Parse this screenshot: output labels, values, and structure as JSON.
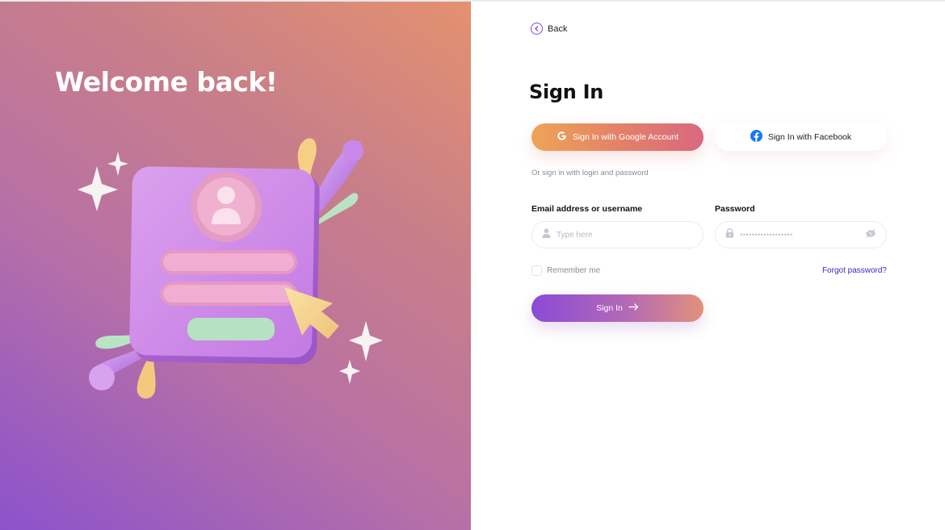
{
  "hero": {
    "title": "Welcome back!"
  },
  "nav": {
    "back_label": "Back"
  },
  "form": {
    "title": "Sign In",
    "google_button": "Sign In with Google Account",
    "facebook_button": "Sign In with Facebook",
    "divider_text": "Or sign in with login and password",
    "email_label": "Email address or username",
    "email_placeholder": "Type here",
    "email_value": "",
    "password_label": "Password",
    "password_masked": "••••••••••••••••••",
    "remember_label": "Remember me",
    "remember_checked": false,
    "forgot_label": "Forgot password?",
    "submit_label": "Sign In"
  },
  "icons": {
    "back": "chevron-left-circle-icon",
    "google": "google-icon",
    "facebook": "facebook-icon",
    "user": "user-icon",
    "lock": "lock-icon",
    "eye": "eye-off-icon",
    "arrow": "arrow-right-icon"
  },
  "colors": {
    "accent_purple": "#8a4ad6",
    "google_orange": "#eea456",
    "google_pink": "#d9687f",
    "facebook_blue": "#1877f2",
    "link_blue": "#3b1fc4",
    "hero_top": "#e4916f",
    "hero_bottom": "#8c52cc"
  }
}
